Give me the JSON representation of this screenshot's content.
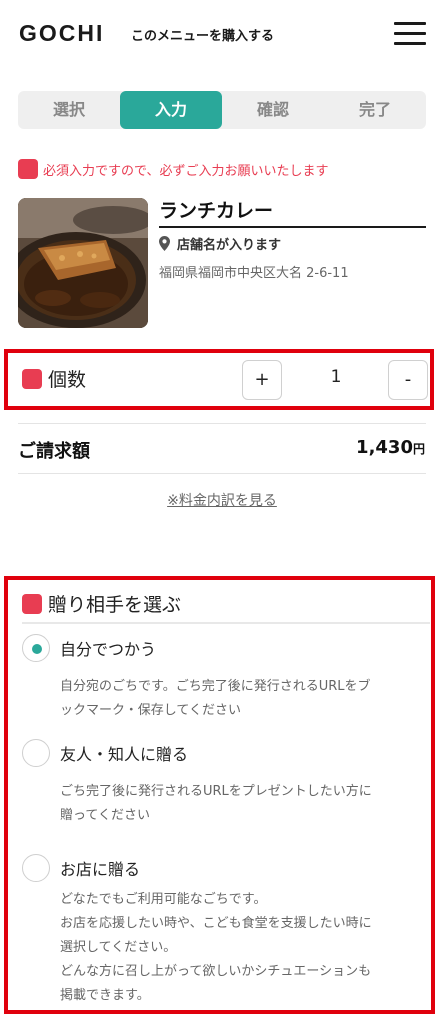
{
  "header": {
    "logo": "GOCHI",
    "tagline": "このメニューを購入する"
  },
  "steps": [
    {
      "label": "選択",
      "active": false
    },
    {
      "label": "入力",
      "active": true
    },
    {
      "label": "確認",
      "active": false
    },
    {
      "label": "完了",
      "active": false
    }
  ],
  "required_note": "必須入力ですので、必ずご入力お願いいたします",
  "product": {
    "name": "ランチカレー",
    "store": "店舗名が入ります",
    "address": "福岡県福岡市中央区大名 2-6-11"
  },
  "quantity": {
    "label": "個数",
    "plus": "+",
    "minus": "-",
    "value": "1"
  },
  "billing": {
    "label": "ご請求額",
    "amount": "1,430",
    "currency": "円",
    "breakdown_link": "※料金内訳を見る"
  },
  "gift": {
    "title": "贈り相手を選ぶ",
    "options": [
      {
        "label": "自分でつかう",
        "selected": true,
        "description": [
          "自分宛のごちです。ごち完了後に発行されるURLをブ",
          "ックマーク・保存してください"
        ]
      },
      {
        "label": "友人・知人に贈る",
        "selected": false,
        "description": [
          "ごち完了後に発行されるURLをプレゼントしたい方に",
          "贈ってください"
        ]
      },
      {
        "label": "お店に贈る",
        "selected": false,
        "description": [
          "どなたでもご利用可能なごちです。",
          "お店を応援したい時や、こども食堂を支援したい時に",
          "選択してください。",
          "どんな方に召し上がって欲しいかシチュエーションも",
          "掲載できます。"
        ]
      }
    ]
  },
  "colors": {
    "accent": "#2aa89a",
    "required": "#e83d52",
    "highlight_border": "#e0000d"
  },
  "icons": {
    "menu": "hamburger-menu-icon",
    "store": "map-pin-icon"
  }
}
